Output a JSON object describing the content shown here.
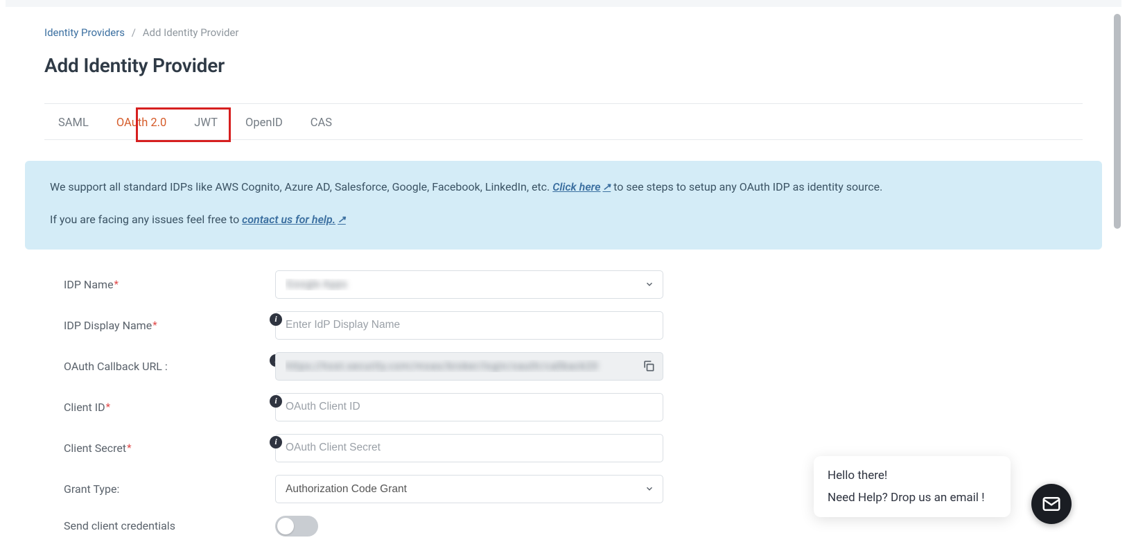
{
  "breadcrumb": {
    "root": "Identity Providers",
    "current": "Add Identity Provider"
  },
  "page_title": "Add Identity Provider",
  "tabs": {
    "items": [
      "SAML",
      "OAuth 2.0",
      "JWT",
      "OpenID",
      "CAS"
    ],
    "active_index": 1
  },
  "banner": {
    "line1_prefix": "We support all standard IDPs like AWS Cognito, Azure AD, Salesforce, Google, Facebook, LinkedIn, etc. ",
    "click_here": "Click here",
    "line1_suffix": " to see steps to setup any OAuth IDP as identity source.",
    "line2_prefix": "If you are facing any issues feel free to ",
    "contact_link": "contact us for help."
  },
  "form": {
    "idp_name": {
      "label": "IDP Name",
      "required": true,
      "value": "Google Apps"
    },
    "idp_display_name": {
      "label": "IDP Display Name",
      "required": true,
      "placeholder": "Enter IdP Display Name",
      "value": ""
    },
    "callback_url": {
      "label": "OAuth Callback URL :",
      "value": "https://host.security.com/moas/broker/login/oauth/callback20"
    },
    "client_id": {
      "label": "Client ID",
      "required": true,
      "placeholder": "OAuth Client ID",
      "value": ""
    },
    "client_secret": {
      "label": "Client Secret",
      "required": true,
      "placeholder": "OAuth Client Secret",
      "value": ""
    },
    "grant_type": {
      "label": "Grant Type:",
      "value": "Authorization Code Grant"
    },
    "send_client_credentials": {
      "label": "Send client credentials",
      "value": false
    }
  },
  "chat": {
    "line1": "Hello there!",
    "line2": "Need Help? Drop us an email !"
  }
}
